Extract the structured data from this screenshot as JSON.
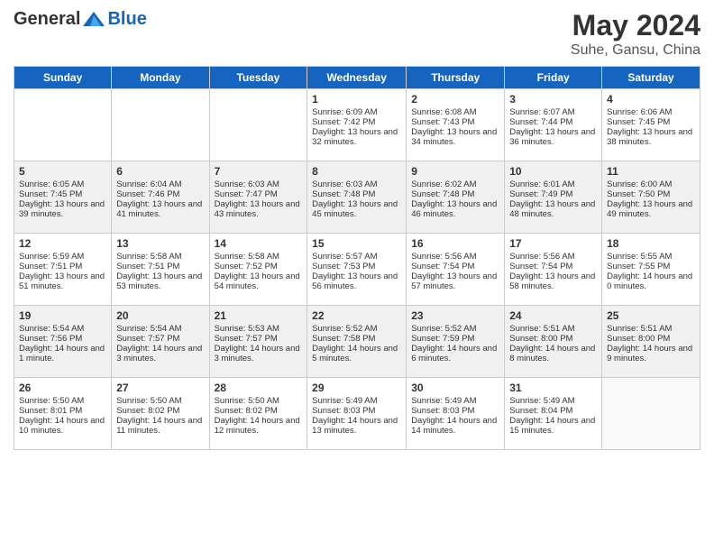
{
  "header": {
    "logo": {
      "general": "General",
      "blue": "Blue"
    },
    "title": "May 2024",
    "subtitle": "Suhe, Gansu, China"
  },
  "weekdays": [
    "Sunday",
    "Monday",
    "Tuesday",
    "Wednesday",
    "Thursday",
    "Friday",
    "Saturday"
  ],
  "weeks": [
    [
      {
        "day": "",
        "empty": true
      },
      {
        "day": "",
        "empty": true
      },
      {
        "day": "",
        "empty": true
      },
      {
        "day": "1",
        "sunrise": "Sunrise: 6:09 AM",
        "sunset": "Sunset: 7:42 PM",
        "daylight": "Daylight: 13 hours and 32 minutes."
      },
      {
        "day": "2",
        "sunrise": "Sunrise: 6:08 AM",
        "sunset": "Sunset: 7:43 PM",
        "daylight": "Daylight: 13 hours and 34 minutes."
      },
      {
        "day": "3",
        "sunrise": "Sunrise: 6:07 AM",
        "sunset": "Sunset: 7:44 PM",
        "daylight": "Daylight: 13 hours and 36 minutes."
      },
      {
        "day": "4",
        "sunrise": "Sunrise: 6:06 AM",
        "sunset": "Sunset: 7:45 PM",
        "daylight": "Daylight: 13 hours and 38 minutes."
      }
    ],
    [
      {
        "day": "5",
        "sunrise": "Sunrise: 6:05 AM",
        "sunset": "Sunset: 7:45 PM",
        "daylight": "Daylight: 13 hours and 39 minutes."
      },
      {
        "day": "6",
        "sunrise": "Sunrise: 6:04 AM",
        "sunset": "Sunset: 7:46 PM",
        "daylight": "Daylight: 13 hours and 41 minutes."
      },
      {
        "day": "7",
        "sunrise": "Sunrise: 6:03 AM",
        "sunset": "Sunset: 7:47 PM",
        "daylight": "Daylight: 13 hours and 43 minutes."
      },
      {
        "day": "8",
        "sunrise": "Sunrise: 6:03 AM",
        "sunset": "Sunset: 7:48 PM",
        "daylight": "Daylight: 13 hours and 45 minutes."
      },
      {
        "day": "9",
        "sunrise": "Sunrise: 6:02 AM",
        "sunset": "Sunset: 7:48 PM",
        "daylight": "Daylight: 13 hours and 46 minutes."
      },
      {
        "day": "10",
        "sunrise": "Sunrise: 6:01 AM",
        "sunset": "Sunset: 7:49 PM",
        "daylight": "Daylight: 13 hours and 48 minutes."
      },
      {
        "day": "11",
        "sunrise": "Sunrise: 6:00 AM",
        "sunset": "Sunset: 7:50 PM",
        "daylight": "Daylight: 13 hours and 49 minutes."
      }
    ],
    [
      {
        "day": "12",
        "sunrise": "Sunrise: 5:59 AM",
        "sunset": "Sunset: 7:51 PM",
        "daylight": "Daylight: 13 hours and 51 minutes."
      },
      {
        "day": "13",
        "sunrise": "Sunrise: 5:58 AM",
        "sunset": "Sunset: 7:51 PM",
        "daylight": "Daylight: 13 hours and 53 minutes."
      },
      {
        "day": "14",
        "sunrise": "Sunrise: 5:58 AM",
        "sunset": "Sunset: 7:52 PM",
        "daylight": "Daylight: 13 hours and 54 minutes."
      },
      {
        "day": "15",
        "sunrise": "Sunrise: 5:57 AM",
        "sunset": "Sunset: 7:53 PM",
        "daylight": "Daylight: 13 hours and 56 minutes."
      },
      {
        "day": "16",
        "sunrise": "Sunrise: 5:56 AM",
        "sunset": "Sunset: 7:54 PM",
        "daylight": "Daylight: 13 hours and 57 minutes."
      },
      {
        "day": "17",
        "sunrise": "Sunrise: 5:56 AM",
        "sunset": "Sunset: 7:54 PM",
        "daylight": "Daylight: 13 hours and 58 minutes."
      },
      {
        "day": "18",
        "sunrise": "Sunrise: 5:55 AM",
        "sunset": "Sunset: 7:55 PM",
        "daylight": "Daylight: 14 hours and 0 minutes."
      }
    ],
    [
      {
        "day": "19",
        "sunrise": "Sunrise: 5:54 AM",
        "sunset": "Sunset: 7:56 PM",
        "daylight": "Daylight: 14 hours and 1 minute."
      },
      {
        "day": "20",
        "sunrise": "Sunrise: 5:54 AM",
        "sunset": "Sunset: 7:57 PM",
        "daylight": "Daylight: 14 hours and 3 minutes."
      },
      {
        "day": "21",
        "sunrise": "Sunrise: 5:53 AM",
        "sunset": "Sunset: 7:57 PM",
        "daylight": "Daylight: 14 hours and 3 minutes."
      },
      {
        "day": "22",
        "sunrise": "Sunrise: 5:52 AM",
        "sunset": "Sunset: 7:58 PM",
        "daylight": "Daylight: 14 hours and 5 minutes."
      },
      {
        "day": "23",
        "sunrise": "Sunrise: 5:52 AM",
        "sunset": "Sunset: 7:59 PM",
        "daylight": "Daylight: 14 hours and 6 minutes."
      },
      {
        "day": "24",
        "sunrise": "Sunrise: 5:51 AM",
        "sunset": "Sunset: 8:00 PM",
        "daylight": "Daylight: 14 hours and 8 minutes."
      },
      {
        "day": "25",
        "sunrise": "Sunrise: 5:51 AM",
        "sunset": "Sunset: 8:00 PM",
        "daylight": "Daylight: 14 hours and 9 minutes."
      }
    ],
    [
      {
        "day": "26",
        "sunrise": "Sunrise: 5:50 AM",
        "sunset": "Sunset: 8:01 PM",
        "daylight": "Daylight: 14 hours and 10 minutes."
      },
      {
        "day": "27",
        "sunrise": "Sunrise: 5:50 AM",
        "sunset": "Sunset: 8:02 PM",
        "daylight": "Daylight: 14 hours and 11 minutes."
      },
      {
        "day": "28",
        "sunrise": "Sunrise: 5:50 AM",
        "sunset": "Sunset: 8:02 PM",
        "daylight": "Daylight: 14 hours and 12 minutes."
      },
      {
        "day": "29",
        "sunrise": "Sunrise: 5:49 AM",
        "sunset": "Sunset: 8:03 PM",
        "daylight": "Daylight: 14 hours and 13 minutes."
      },
      {
        "day": "30",
        "sunrise": "Sunrise: 5:49 AM",
        "sunset": "Sunset: 8:03 PM",
        "daylight": "Daylight: 14 hours and 14 minutes."
      },
      {
        "day": "31",
        "sunrise": "Sunrise: 5:49 AM",
        "sunset": "Sunset: 8:04 PM",
        "daylight": "Daylight: 14 hours and 15 minutes."
      },
      {
        "day": "",
        "empty": true
      }
    ]
  ]
}
